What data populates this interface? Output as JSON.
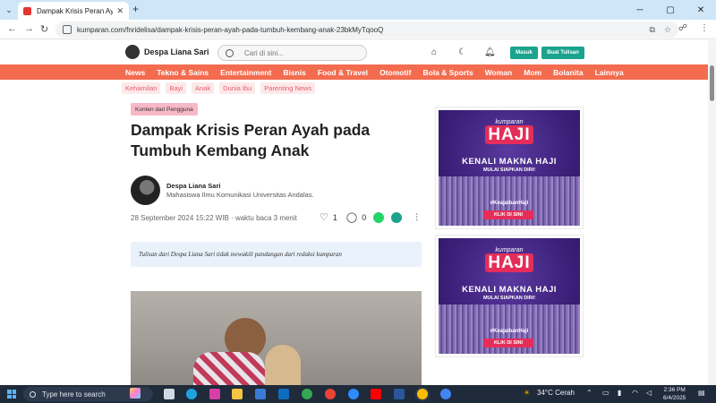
{
  "browser": {
    "tab_title": "Dampak Krisis Peran Ayah pada Tumbuh Kembang Anak | kumparan.com",
    "tab_close": "✕",
    "new_tab": "+",
    "url": "kumparan.com/fnridelisa/dampak-krisis-peran-ayah-pada-tumbuh-kembang-anak-23bkMyTqooQ"
  },
  "header": {
    "author_name": "Despa Liana Sari",
    "search_placeholder": "Cari di sini...",
    "login_label": "Masuk",
    "write_label": "Buat Tulisan"
  },
  "nav": {
    "categories": [
      "News",
      "Tekno & Sains",
      "Entertainment",
      "Bisnis",
      "Food & Travel",
      "Otomotif",
      "Bola & Sports",
      "Woman",
      "Mom",
      "Bolanita",
      "Lainnya"
    ],
    "subcategories": [
      "Kehamilan",
      "Bayi",
      "Anak",
      "Dunia Ibu",
      "Parenting News"
    ]
  },
  "article": {
    "badge": "Konten dari Pengguna",
    "title": "Dampak Krisis Peran Ayah pada Tumbuh Kembang Anak",
    "author_name": "Despa Liana Sari",
    "author_desc": "Mahasiswa Ilmu Komunikasi Universitas Andalas.",
    "meta": "28 September 2024 15:22 WIB · waktu baca 3 menit",
    "likes": "1",
    "comments": "0",
    "disclaimer": "Tulisan dari Despa Liana Sari tidak mewakili pandangan dari redaksi kumparan"
  },
  "ads": [
    {
      "brand": "kumparan",
      "title": "HAJI",
      "headline": "KENALI MAKNA HAJI",
      "sub": "MULAI SIAPKAN DIRI!",
      "tag": "#KeajaibanHaji",
      "cta": "KLIK DI SINI"
    },
    {
      "brand": "kumparan",
      "title": "HAJI",
      "headline": "KENALI MAKNA HAJI",
      "sub": "MULAI SIAPKAN DIRI!",
      "tag": "#KeajaibanHaji",
      "cta": "KLIK DI SINI"
    }
  ],
  "taskbar": {
    "search_placeholder": "Type here to search",
    "weather": "34°C  Cerah",
    "time": "2:36 PM",
    "date": "6/4/2025"
  },
  "colors": {
    "accent": "#f36c4f",
    "button": "#1aa38d",
    "taskbar": "#1f2a3a"
  }
}
